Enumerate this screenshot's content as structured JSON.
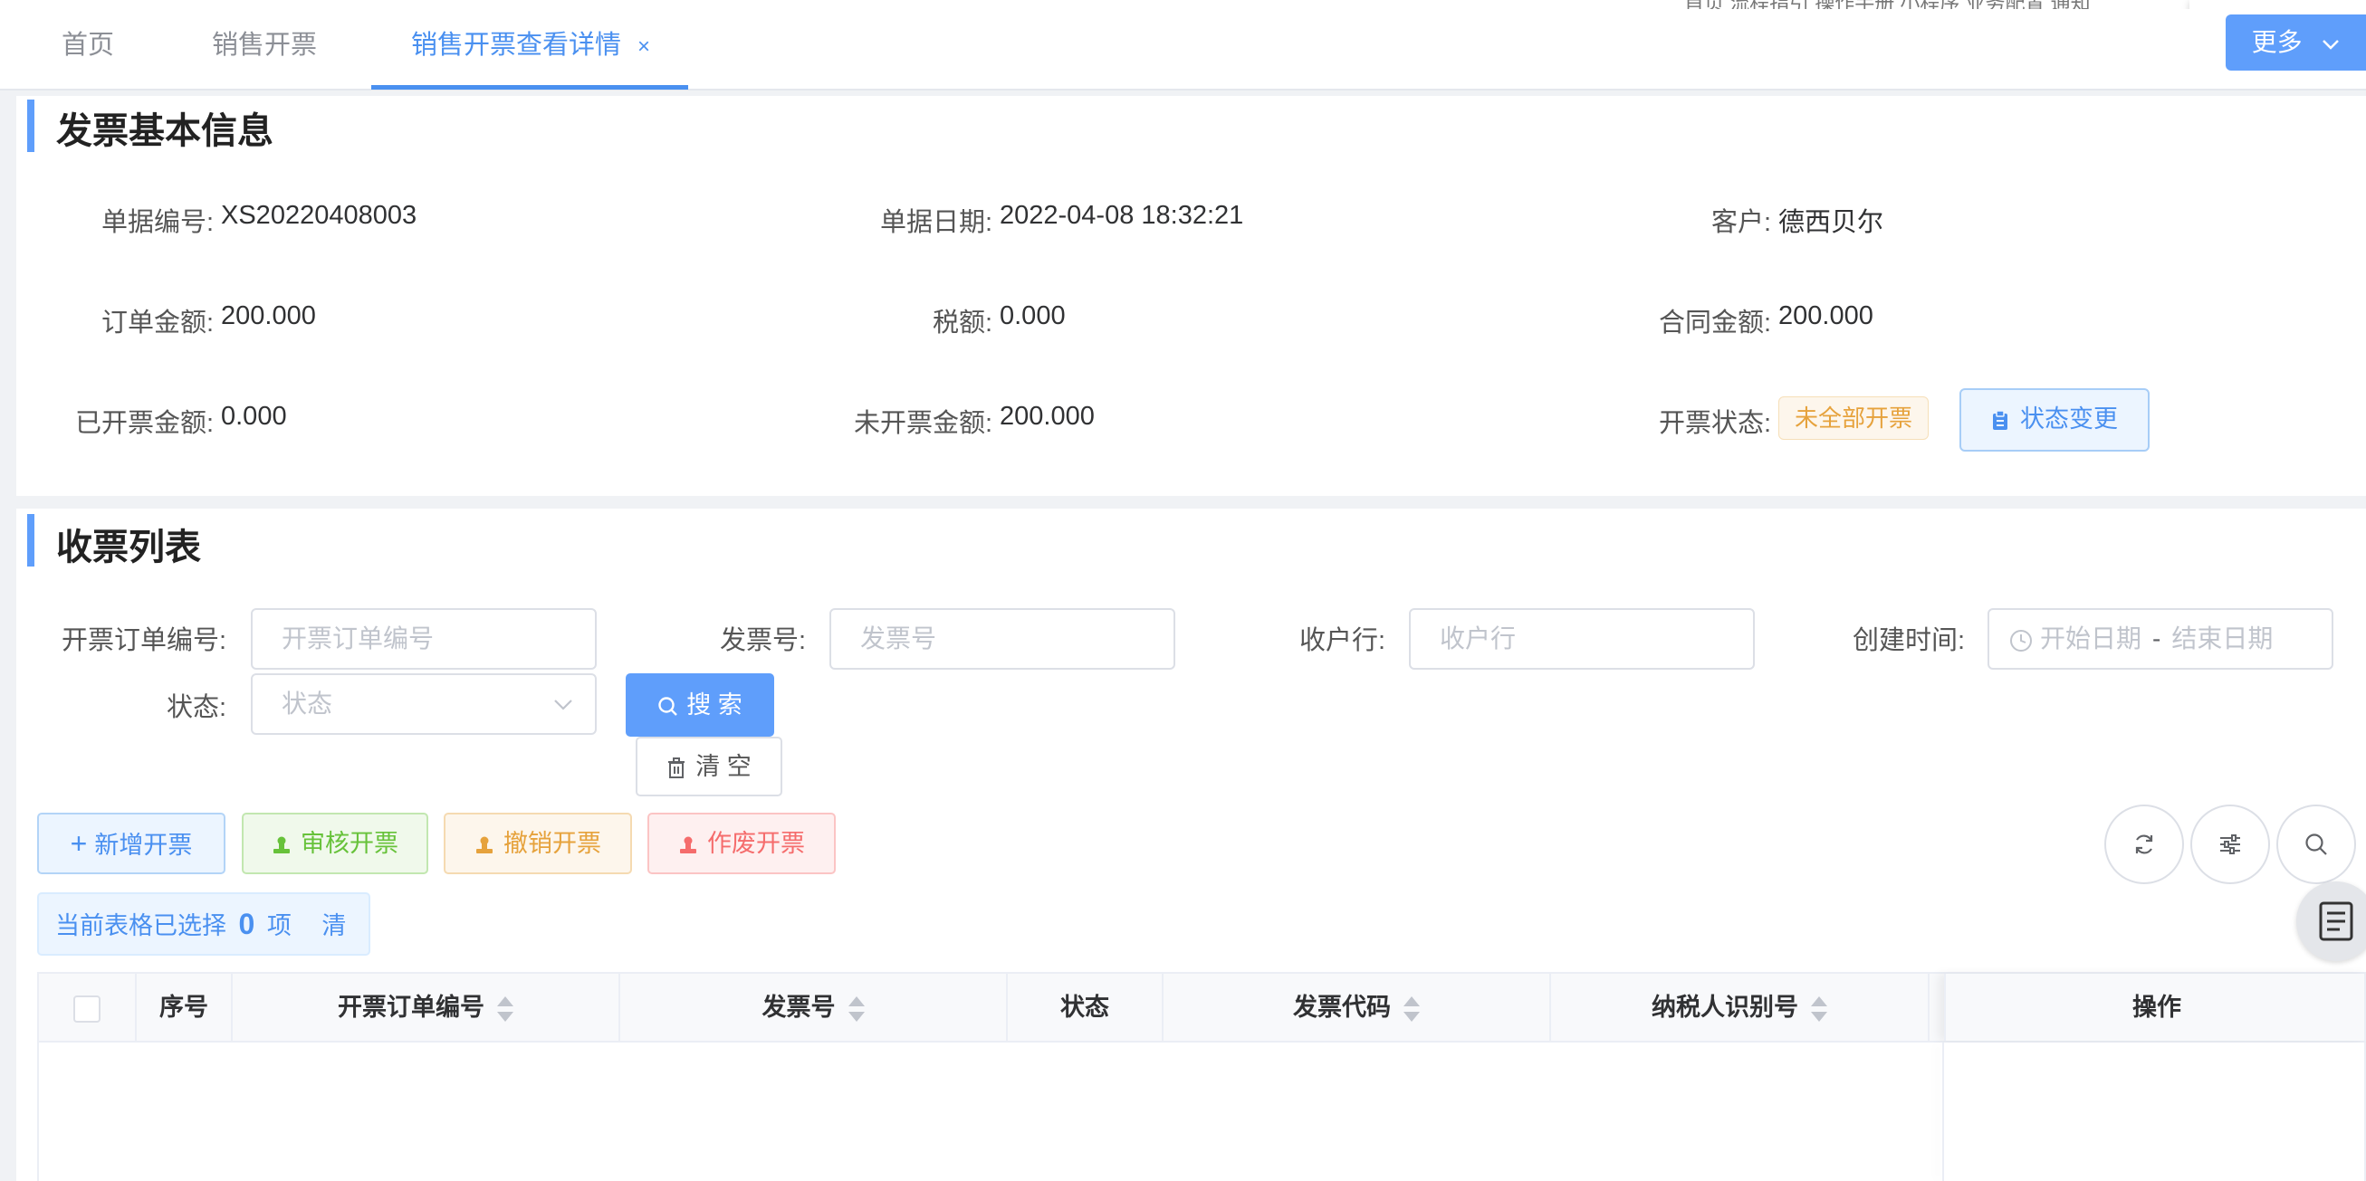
{
  "topnav": {
    "text": "首页   流程指引   操作手册   小程序   业务配置   通知"
  },
  "tabs": [
    {
      "label": "首页"
    },
    {
      "label": "销售开票"
    },
    {
      "label": "销售开票查看详情",
      "close": "×"
    }
  ],
  "more_button": {
    "label": "更多"
  },
  "basic_info": {
    "title": "发票基本信息",
    "fields": {
      "doc_no": {
        "label": "单据编号:",
        "value": "XS20220408003"
      },
      "doc_date": {
        "label": "单据日期:",
        "value": "2022-04-08 18:32:21"
      },
      "customer": {
        "label": "客户:",
        "value": "德西贝尔"
      },
      "order_amount": {
        "label": "订单金额:",
        "value": "200.000"
      },
      "tax": {
        "label": "税额:",
        "value": "0.000"
      },
      "contract_amount": {
        "label": "合同金额:",
        "value": "200.000"
      },
      "invoiced_amount": {
        "label": "已开票金额:",
        "value": "0.000"
      },
      "uninvoiced_amount": {
        "label": "未开票金额:",
        "value": "200.000"
      },
      "invoice_status": {
        "label": "开票状态:",
        "value": "未全部开票"
      }
    },
    "status_change_button": "状态变更"
  },
  "receipt_list": {
    "title": "收票列表",
    "filters": {
      "order_no": {
        "label": "开票订单编号:",
        "placeholder": "开票订单编号"
      },
      "invoice_no": {
        "label": "发票号:",
        "placeholder": "发票号"
      },
      "bank": {
        "label": "收户行:",
        "placeholder": "收户行"
      },
      "created": {
        "label": "创建时间:",
        "start": "开始日期",
        "sep": "-",
        "end": "结束日期"
      },
      "status": {
        "label": "状态:",
        "placeholder": "状态"
      }
    },
    "search_button": "搜 索",
    "clear_button": "清 空",
    "actions": {
      "add": "新增开票",
      "audit": "审核开票",
      "revoke": "撤销开票",
      "void": "作废开票"
    },
    "selection": {
      "prefix": "当前表格已选择",
      "count": "0",
      "suffix": "项",
      "clear": "清 空"
    },
    "columns": [
      "序号",
      "开票订单编号",
      "发票号",
      "状态",
      "发票代码",
      "纳税人识别号",
      "操作"
    ]
  },
  "colors": {
    "primary": "#5f9efb",
    "accent_text": "#4a90f0"
  }
}
